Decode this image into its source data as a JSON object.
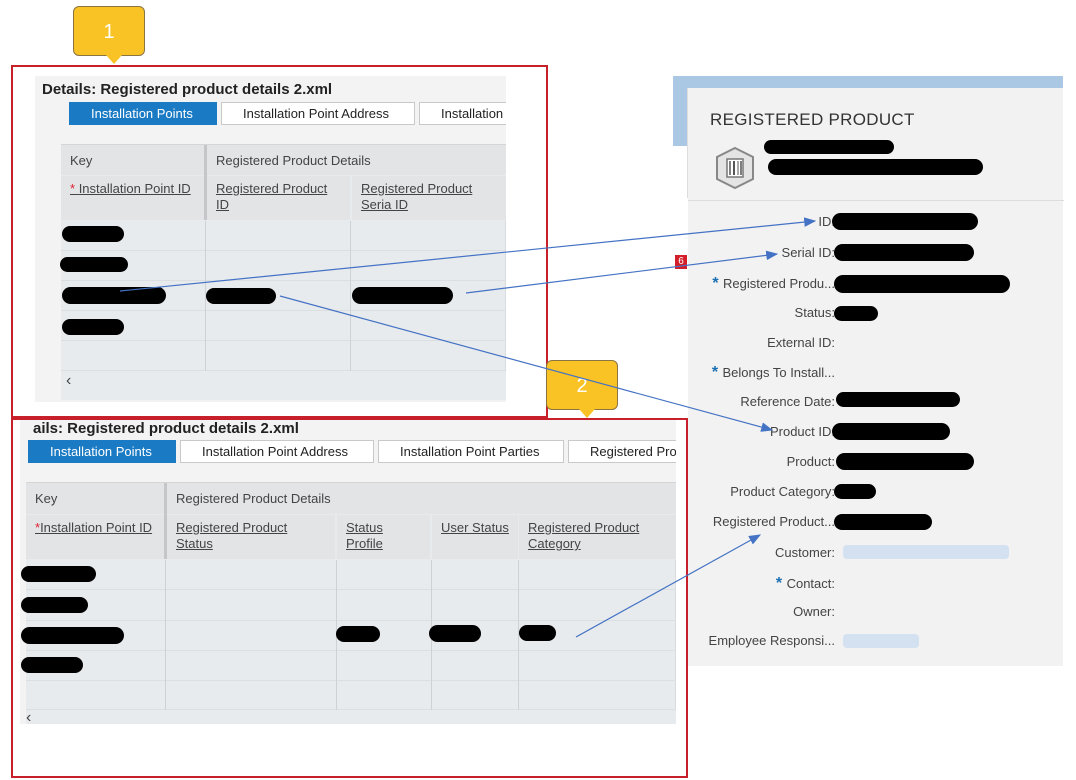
{
  "callouts": [
    "1",
    "2"
  ],
  "panel1": {
    "title": "Details: Registered product details 2.xml",
    "tabs": [
      "Installation Points",
      "Installation Point Address",
      "Installation"
    ],
    "group_headers": [
      "Key",
      "Registered Product Details"
    ],
    "columns": [
      "Installation Point ID",
      "Registered Product ID",
      "Registered Product Seria ID"
    ],
    "scroll_glyph": "‹"
  },
  "panel2": {
    "title": "ails: Registered product details 2.xml",
    "tabs": [
      "Installation Points",
      "Installation Point Address",
      "Installation Point Parties",
      "Registered Pro"
    ],
    "group_headers": [
      "Key",
      "Registered Product Details"
    ],
    "columns": [
      "Installation Point ID",
      "Registered Product Status",
      "Status Profile",
      "User Status",
      "Registered Product Category"
    ],
    "scroll_glyph": "‹"
  },
  "registered_product": {
    "title": "REGISTERED PRODUCT",
    "fields": [
      {
        "label": "ID:",
        "required": false
      },
      {
        "label": "Serial ID:",
        "required": false
      },
      {
        "label": "Registered Produ...",
        "required": true
      },
      {
        "label": "Status:",
        "required": false
      },
      {
        "label": "External ID:",
        "required": false
      },
      {
        "label": "Belongs To Install...",
        "required": true
      },
      {
        "label": "Reference Date:",
        "required": false
      },
      {
        "label": "Product ID:",
        "required": false
      },
      {
        "label": "Product:",
        "required": false
      },
      {
        "label": "Product Category:",
        "required": false
      },
      {
        "label": "Registered Product...",
        "required": false
      },
      {
        "label": "Customer:",
        "required": false
      },
      {
        "label": "Contact:",
        "required": true
      },
      {
        "label": "Owner:",
        "required": false
      },
      {
        "label": "Employee Responsi...",
        "required": false
      }
    ],
    "side_badge": "6",
    "accent": "#1a7ac3"
  }
}
